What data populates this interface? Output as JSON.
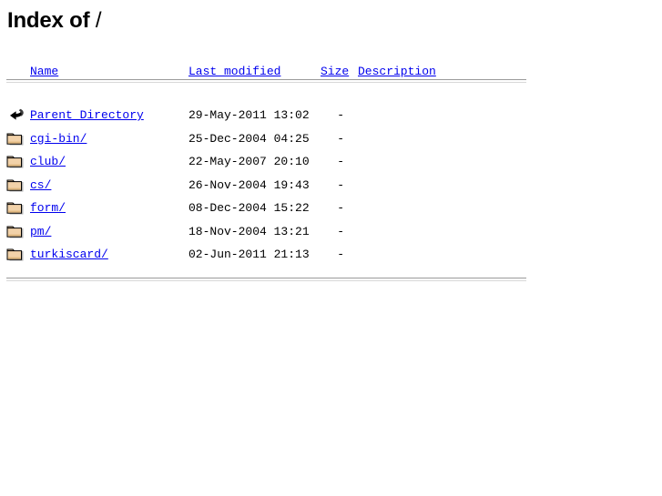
{
  "page": {
    "title_prefix": "Index of ",
    "title_path": "/"
  },
  "table": {
    "headers": {
      "name": "Name",
      "last_modified": "Last modified",
      "size": "Size",
      "description": "Description"
    },
    "rows": [
      {
        "icon": "back-arrow-icon",
        "name": "Parent Directory",
        "last_modified": "29-May-2011 13:02",
        "size": "-",
        "description": ""
      },
      {
        "icon": "folder-icon",
        "name": "cgi-bin/",
        "last_modified": "25-Dec-2004 04:25",
        "size": "-",
        "description": ""
      },
      {
        "icon": "folder-icon",
        "name": "club/",
        "last_modified": "22-May-2007 20:10",
        "size": "-",
        "description": ""
      },
      {
        "icon": "folder-icon",
        "name": "cs/",
        "last_modified": "26-Nov-2004 19:43",
        "size": "-",
        "description": ""
      },
      {
        "icon": "folder-icon",
        "name": "form/",
        "last_modified": "08-Dec-2004 15:22",
        "size": "-",
        "description": ""
      },
      {
        "icon": "folder-icon",
        "name": "pm/",
        "last_modified": "18-Nov-2004 13:21",
        "size": "-",
        "description": ""
      },
      {
        "icon": "folder-icon",
        "name": "turkiscard/",
        "last_modified": "02-Jun-2011 21:13",
        "size": "-",
        "description": ""
      }
    ]
  },
  "colors": {
    "link": "#0000EE",
    "text": "#000000",
    "background": "#FFFFFF",
    "folder_fill": "#F2D2A9",
    "folder_shade": "#E0B880",
    "folder_outline": "#000000",
    "rule_dark": "#9A9A9A",
    "rule_light": "#D8D8D8"
  }
}
